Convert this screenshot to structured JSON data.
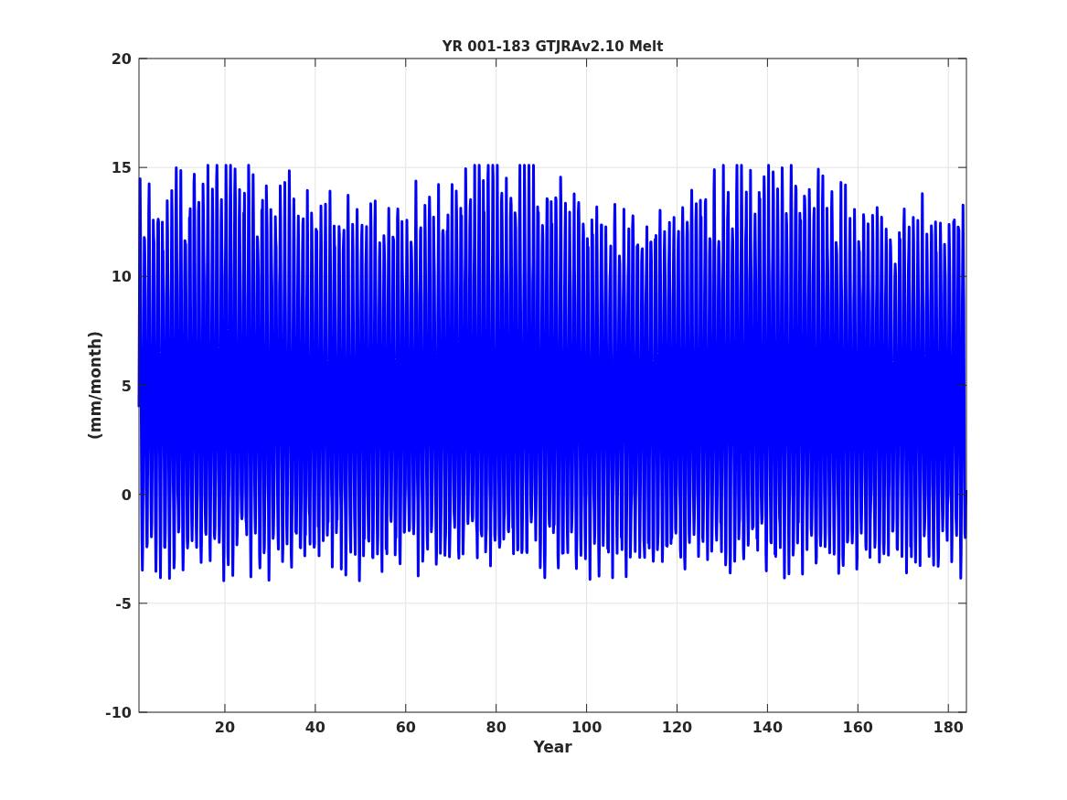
{
  "figure": {
    "title": "YR 001-183 GTJRAv2.10 Melt",
    "xlabel": "Year",
    "ylabel": "(mm/month)",
    "xticks": [
      "20",
      "40",
      "60",
      "80",
      "100",
      "120",
      "140",
      "160",
      "180"
    ],
    "yticks": [
      "20",
      "15",
      "10",
      "5",
      "0",
      "-5",
      "-10"
    ]
  }
}
